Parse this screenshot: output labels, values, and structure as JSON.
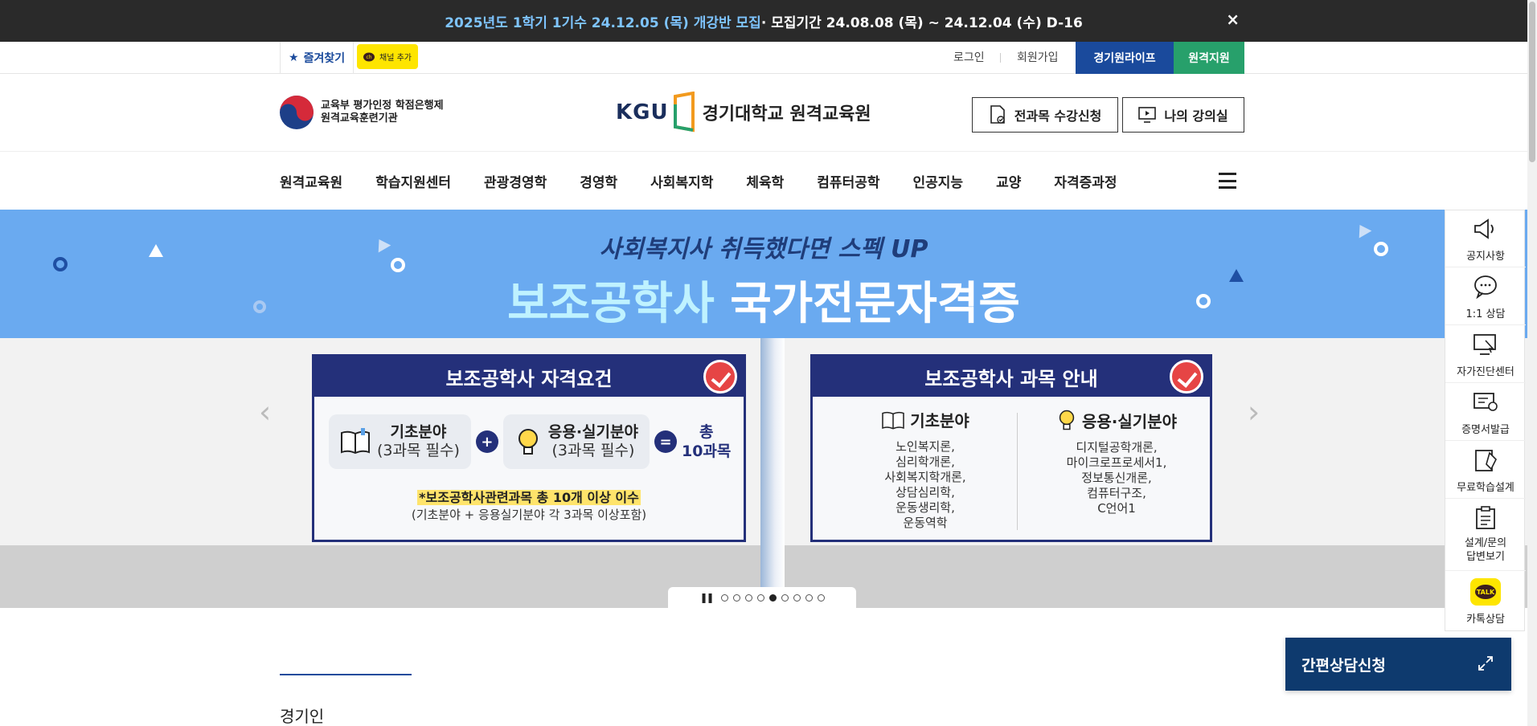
{
  "notice": {
    "highlight": "2025년도 1학기 1기수 24.12.05 (목) 개강반 모집",
    "rest": " · 모집기간 24.08.08 (목) ~ 24.12.04 (수) D-16",
    "close": "×"
  },
  "util": {
    "favorite": "즐겨찾기",
    "channel": "채널 추가",
    "login": "로그인",
    "join": "회원가입",
    "life": "경기원라이프",
    "support": "원격지원"
  },
  "header": {
    "moe_line1": "교육부 평가인정 학점은행제",
    "moe_line2": "원격교육훈련기관",
    "logo_kgu": "KGU",
    "logo_name": "경기대학교 원격교육원",
    "btn_enroll": "전과목 수강신청",
    "btn_mylecture": "나의 강의실"
  },
  "gnb": [
    "원격교육원",
    "학습지원센터",
    "관광경영학",
    "경영학",
    "사회복지학",
    "체육학",
    "컴퓨터공학",
    "인공지능",
    "교양",
    "자격증과정"
  ],
  "banner": {
    "subtitle": "사회복지사 취득했다면 스펙 UP",
    "title_accent": "보조공학사",
    "title_rest": " 국가전문자격증",
    "card1": {
      "title": "보조공학사 자격요건",
      "basic_title": "기초분야",
      "basic_sub": "(3과목 필수)",
      "applied_title": "응용·실기분야",
      "applied_sub": "(3과목 필수)",
      "plus": "+",
      "equals": "=",
      "total_line1": "총",
      "total_line2": "10과목",
      "note_highlight": "*보조공학사관련과목 총 10개 이상 이수",
      "note": "(기초분야 + 응용실기분야 각 3과목 이상포함)"
    },
    "card2": {
      "title": "보조공학사 과목 안내",
      "basic_title": "기초분야",
      "basic_list": [
        "노인복지론,",
        "심리학개론,",
        "사회복지학개론,",
        "상담심리학,",
        "운동생리학,",
        "운동역학"
      ],
      "applied_title": "응용·실기분야",
      "applied_list": [
        "디지털공학개론,",
        "마이크로프로세서1,",
        "정보통신개론,",
        "컴퓨터구조,",
        "C언어1"
      ]
    },
    "prev": "‹",
    "next": "›",
    "pause": "❚❚",
    "slide_count": 9,
    "active_slide": 5
  },
  "section": {
    "title": "경기인"
  },
  "quick": [
    {
      "icon": "megaphone-icon",
      "label": "공지사항"
    },
    {
      "icon": "chat-icon",
      "label": "1:1 상담"
    },
    {
      "icon": "monitor-check-icon",
      "label": "자가진단센터"
    },
    {
      "icon": "certificate-icon",
      "label": "증명서발급"
    },
    {
      "icon": "plan-icon",
      "label": "무료학습설계"
    },
    {
      "icon": "clipboard-icon",
      "label": "설계/문의\n답변보기"
    },
    {
      "icon": "kakaotalk-icon",
      "label": "카톡상담"
    }
  ],
  "kakao_badge": "TALK",
  "consult": {
    "label": "간편상담신청"
  },
  "colors": {
    "primary": "#1a4a9c",
    "support": "#27a06b",
    "banner_sky": "#6aaaf0",
    "card_navy": "#24307a",
    "consult": "#0e3a6e"
  }
}
